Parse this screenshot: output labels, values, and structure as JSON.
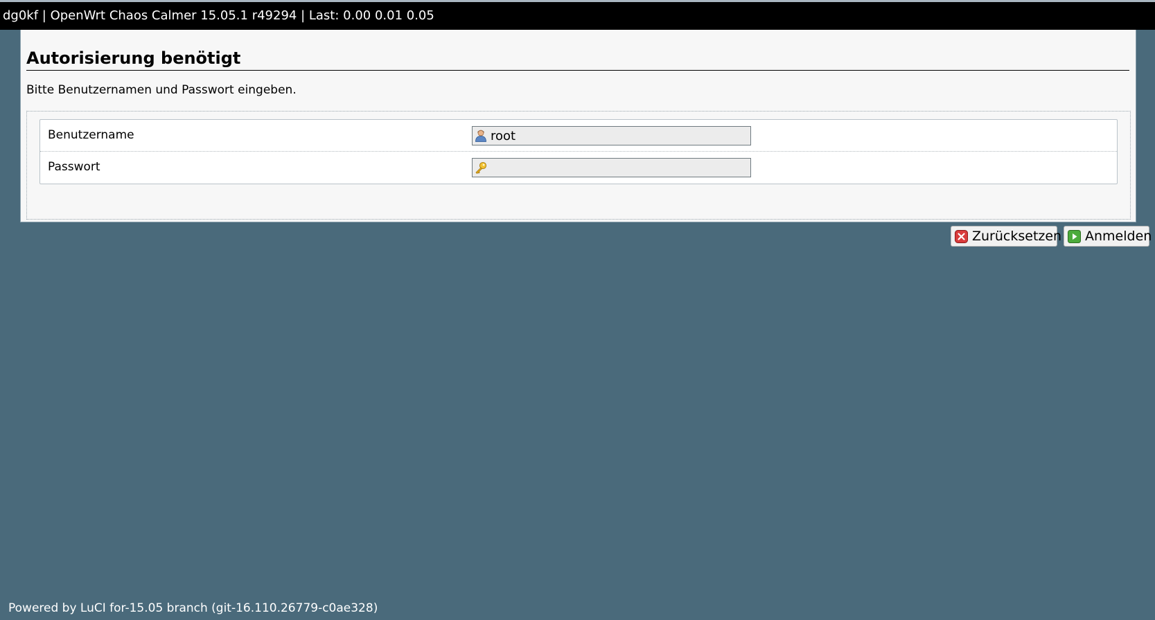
{
  "header": {
    "hostname": "dg0kf",
    "system": "OpenWrt Chaos Calmer 15.05.1 r49294",
    "load_label": "Last:",
    "load_values": "0.00 0.01 0.05",
    "text": "dg0kf | OpenWrt Chaos Calmer 15.05.1 r49294 | Last: 0.00 0.01 0.05"
  },
  "main": {
    "title": "Autorisierung benötigt",
    "intro": "Bitte Benutzernamen und Passwort eingeben.",
    "fields": [
      {
        "label": "Benutzername",
        "value": "root",
        "icon": "user-icon"
      },
      {
        "label": "Passwort",
        "value": "",
        "icon": "key-icon"
      }
    ],
    "buttons": {
      "reset_label": "Zurücksetzen",
      "reset_icon": "reset-x-icon",
      "login_label": "Anmelden",
      "login_icon": "login-arrow-icon"
    }
  },
  "footer": {
    "text": "Powered by LuCI for-15.05 branch (git-16.110.26779-c0ae328)"
  },
  "colors": {
    "background": "#4a6a7b",
    "header_bar": "#000000",
    "panel": "#f7f7f7",
    "input_bg": "#ececec"
  }
}
